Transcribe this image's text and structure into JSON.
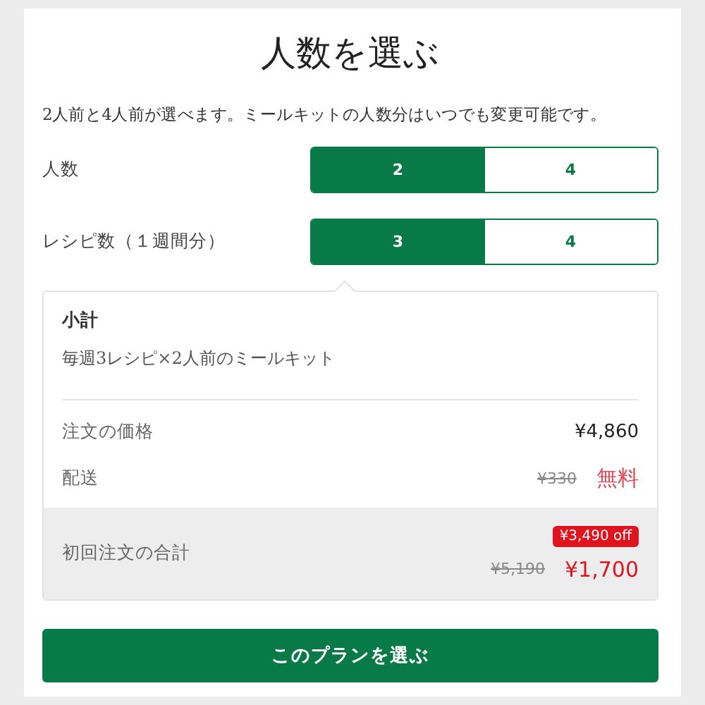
{
  "title": "人数を選ぶ",
  "description": "2人前と4人前が選べます。ミールキットの人数分はいつでも変更可能です。",
  "selectors": [
    {
      "label": "人数",
      "options": [
        {
          "label": "2",
          "selected": true
        },
        {
          "label": "4",
          "selected": false
        }
      ]
    },
    {
      "label": "レシピ数（１週間分）",
      "options": [
        {
          "label": "3",
          "selected": true
        },
        {
          "label": "4",
          "selected": false
        }
      ]
    }
  ],
  "summary": {
    "heading": "小計",
    "plan": "毎週3レシピ×2人前のミールキット",
    "lines": [
      {
        "label": "注文の価格",
        "price": "¥4,860"
      },
      {
        "label": "配送",
        "old_price": "¥330",
        "price": "無料"
      }
    ],
    "total": {
      "label": "初回注文の合計",
      "discount": "¥3,490 off",
      "old_price": "¥5,190",
      "price": "¥1,700"
    }
  },
  "button": "このプランを選ぶ"
}
